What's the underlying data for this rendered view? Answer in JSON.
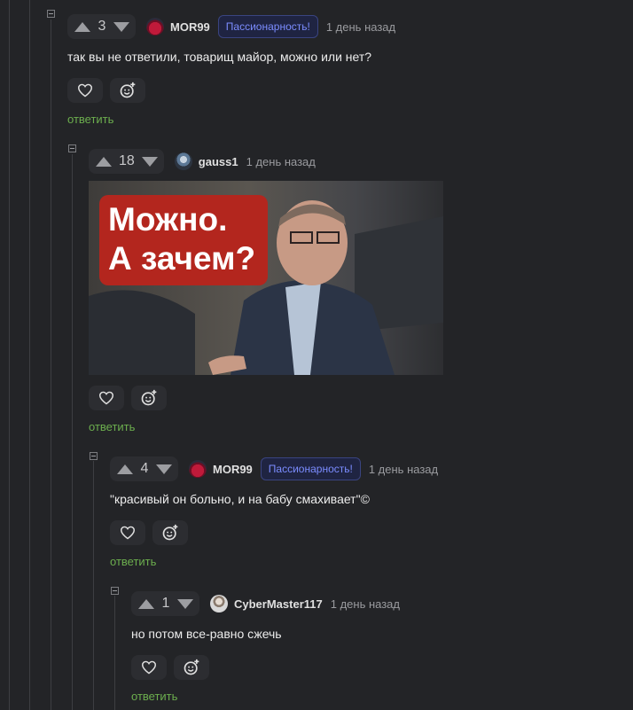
{
  "comments": [
    {
      "score": "3",
      "user": "MOR99",
      "badge": "Пассионарность!",
      "time": "1 день назад",
      "text": "так вы не ответили, товарищ майор, можно или нет?",
      "reply": "ответить"
    },
    {
      "score": "18",
      "user": "gauss1",
      "time": "1 день назад",
      "image_caption": "Можно.\nА зачем?",
      "reply": "ответить"
    },
    {
      "score": "4",
      "user": "MOR99",
      "badge": "Пассионарность!",
      "time": "1 день назад",
      "text": "\"красивый он больно, и на бабу смахивает\"©",
      "reply": "ответить"
    },
    {
      "score": "1",
      "user": "CyberMaster117",
      "time": "1 день назад",
      "text": "но потом все-равно сжечь",
      "reply": "ответить"
    }
  ],
  "image_caption_lines": [
    "Можно.",
    "А зачем?"
  ],
  "icons": {
    "collapse": "minus-square-icon",
    "upvote": "arrow-up-icon",
    "downvote": "arrow-down-icon",
    "like": "heart-icon",
    "react": "smile-plus-icon"
  },
  "colors": {
    "background": "#232427",
    "reply_link": "#6cae4e",
    "badge_text": "#7b8cff",
    "image_caption_bg": "#b3261e"
  }
}
